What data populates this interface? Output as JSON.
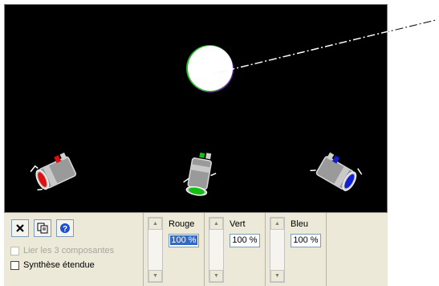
{
  "toolbar": {
    "close_icon": "close-icon",
    "copy_icon": "copy-icon",
    "help_icon": "help-icon"
  },
  "options": {
    "link_label": "Lier les 3 composantes",
    "link_enabled": false,
    "link_checked": false,
    "extended_label": "Synthèse étendue",
    "extended_checked": false
  },
  "channels": [
    {
      "label": "Rouge",
      "value": "100 %",
      "selected": true,
      "color": "#ff0000"
    },
    {
      "label": "Vert",
      "value": "100 %",
      "selected": false,
      "color": "#00c000"
    },
    {
      "label": "Bleu",
      "value": "100 %",
      "selected": false,
      "color": "#0000ff"
    }
  ],
  "scene": {
    "background": "#000000",
    "mixed_light_color": "#ffffff",
    "spot_colors": [
      "#ff0000",
      "#00c000",
      "#0000ff"
    ]
  }
}
